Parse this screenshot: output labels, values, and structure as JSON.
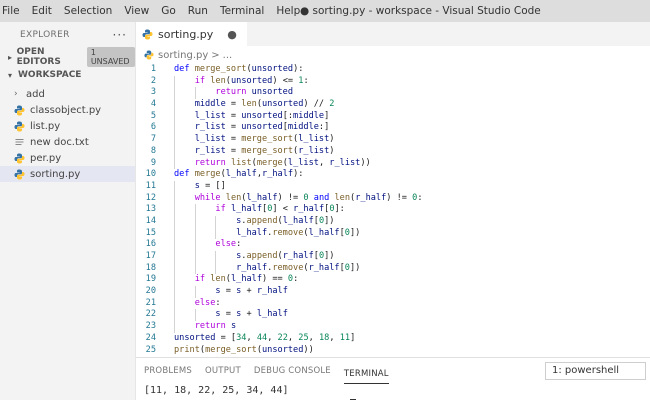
{
  "menu": [
    "File",
    "Edit",
    "Selection",
    "View",
    "Go",
    "Run",
    "Terminal",
    "Help"
  ],
  "window_title": "● sorting.py - workspace - Visual Studio Code",
  "sidebar": {
    "title": "EXPLORER",
    "more": "···",
    "open_editors": {
      "label": "OPEN EDITORS",
      "badge": "1 UNSAVED"
    },
    "workspace": {
      "label": "WORKSPACE"
    },
    "items": [
      {
        "label": "add",
        "type": "folder"
      },
      {
        "label": "classobject.py",
        "type": "python"
      },
      {
        "label": "list.py",
        "type": "python"
      },
      {
        "label": "new doc.txt",
        "type": "text"
      },
      {
        "label": "per.py",
        "type": "python"
      },
      {
        "label": "sorting.py",
        "type": "python",
        "active": true
      }
    ]
  },
  "editor": {
    "tab_label": "sorting.py",
    "tab_close": "●",
    "breadcrumb_file": "sorting.py",
    "breadcrumb_sep": ">",
    "breadcrumb_more": "...",
    "lines": [
      "def merge_sort(unsorted):",
      "    if len(unsorted) <= 1:",
      "        return unsorted",
      "    middle = len(unsorted) // 2",
      "    l_list = unsorted[:middle]",
      "    r_list = unsorted[middle:]",
      "    l_list = merge_sort(l_list)",
      "    r_list = merge_sort(r_list)",
      "    return list(merge(l_list, r_list))",
      "def merge(l_half,r_half):",
      "    s = []",
      "    while len(l_half) != 0 and len(r_half) != 0:",
      "        if l_half[0] < r_half[0]:",
      "            s.append(l_half[0])",
      "            l_half.remove(l_half[0])",
      "        else:",
      "            s.append(r_half[0])",
      "            r_half.remove(r_half[0])",
      "    if len(l_half) == 0:",
      "        s = s + r_half",
      "    else:",
      "        s = s + l_half",
      "    return s",
      "unsorted = [34, 44, 22, 25, 18, 11]",
      "print(merge_sort(unsorted))"
    ]
  },
  "panel": {
    "tabs": [
      "PROBLEMS",
      "OUTPUT",
      "DEBUG CONSOLE",
      "TERMINAL"
    ],
    "active_tab": "TERMINAL",
    "terminal_select": "1: powershell",
    "terminal_output": "[11, 18, 22, 25, 34, 44]"
  },
  "colors": {
    "python_icon": "#3572a5",
    "python_icon_yellow": "#ffd43b",
    "line_number": "#237893",
    "keyword": "#0000ff",
    "number": "#098658"
  }
}
